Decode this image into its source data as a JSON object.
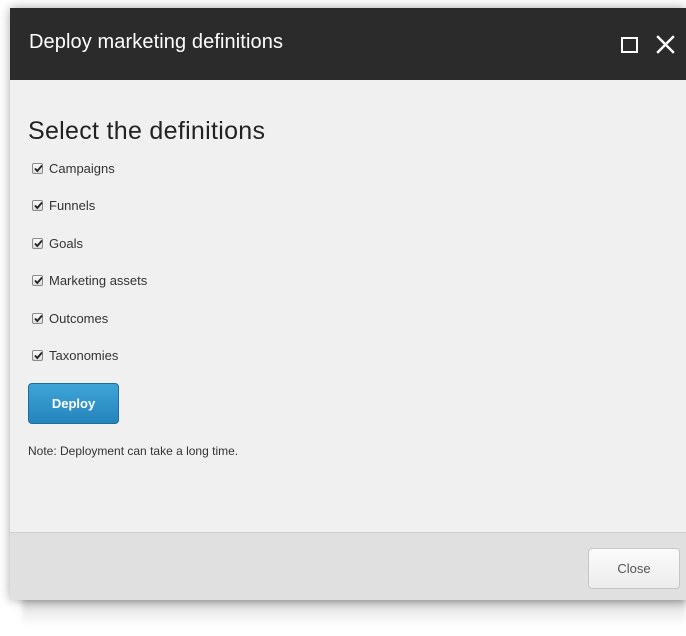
{
  "dialog": {
    "title": "Deploy marketing definitions",
    "heading": "Select the definitions",
    "options": [
      {
        "label": "Campaigns",
        "checked": true
      },
      {
        "label": "Funnels",
        "checked": true
      },
      {
        "label": "Goals",
        "checked": true
      },
      {
        "label": "Marketing assets",
        "checked": true
      },
      {
        "label": "Outcomes",
        "checked": true
      },
      {
        "label": "Taxonomies",
        "checked": true
      }
    ],
    "deploy_label": "Deploy",
    "note": "Note: Deployment can take a long time.",
    "close_label": "Close"
  },
  "icons": {
    "maximize": "maximize-icon",
    "close": "close-icon",
    "checkmark": "checkmark-icon"
  },
  "colors": {
    "titlebar": "#2b2b2b",
    "body": "#f0f0f0",
    "footer": "#e0e0e0",
    "primary_button": "#2a8ac4"
  }
}
